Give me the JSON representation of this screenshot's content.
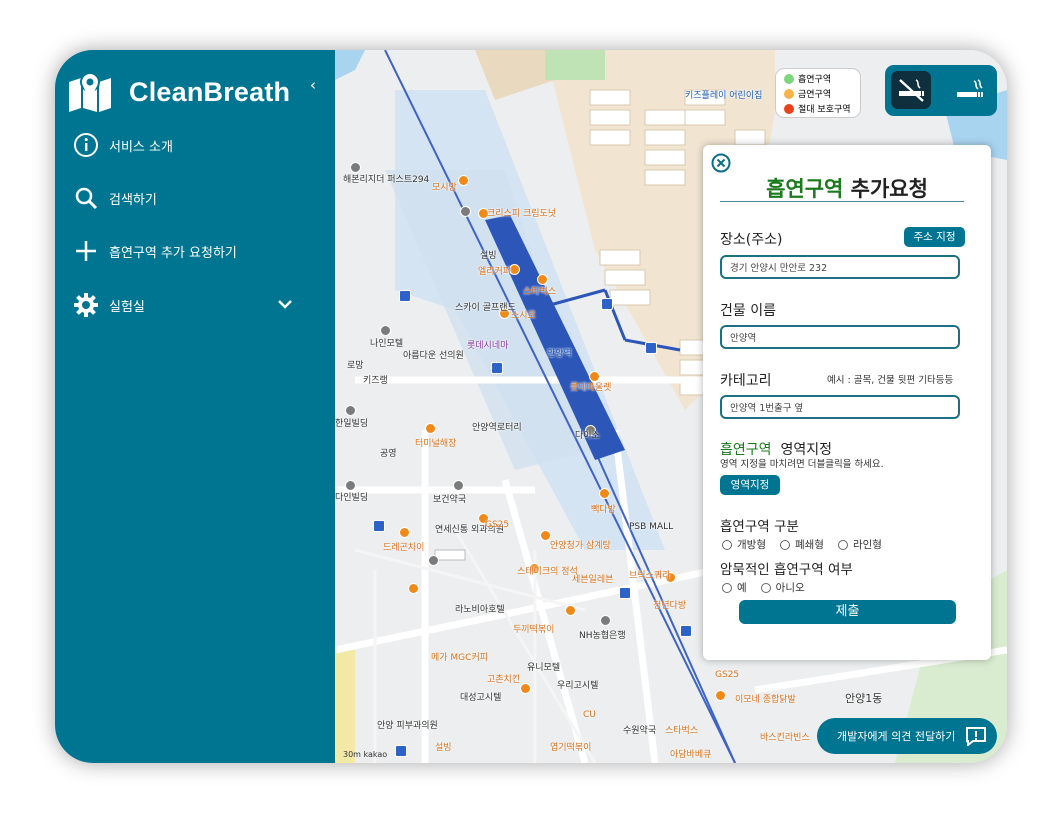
{
  "app": {
    "name": "CleanBreath",
    "collapse_glyph": "‹"
  },
  "sidebar": {
    "items": [
      {
        "label": "서비스 소개",
        "icon": "info-icon"
      },
      {
        "label": "검색하기",
        "icon": "search-icon"
      },
      {
        "label": "흡연구역 추가 요청하기",
        "icon": "plus-icon"
      },
      {
        "label": "실험실",
        "icon": "gear-icon"
      }
    ]
  },
  "legend": [
    {
      "label": "흡연구역",
      "color": "#7ed67e"
    },
    {
      "label": "금연구역",
      "color": "#f7b24c"
    },
    {
      "label": "절대 보호구역",
      "color": "#e8441c"
    }
  ],
  "map_labels": {
    "poi": [
      "해본리지더 퍼스트294",
      "모시망",
      "크리스피 크림도넛",
      "설빙",
      "엘리커피",
      "스타벅스",
      "스카이 골프랜드",
      "스시로",
      "안양역",
      "롯데시네마",
      "나인모텔",
      "아름다운 선의원",
      "로망",
      "키즈랭",
      "롯데아울렛",
      "한일빌딩",
      "안양역로터리",
      "다이소",
      "공영",
      "터미널해장",
      "보건약국",
      "다인빌딩",
      "연세신통 외과의원",
      "GS25",
      "PSB MALL",
      "드레곤차이",
      "빽다방",
      "안양청가 삼계탕",
      "스테이크의 정석",
      "세븐일레븐",
      "브릭스쿼라",
      "청년다방",
      "라노비아호텔",
      "NH농협은행",
      "유니모텔",
      "고촌치킨",
      "우리고시텔",
      "대성고시텔",
      "CU",
      "이모네 종합닭발",
      "수원약국",
      "스타벅스",
      "아담바베큐",
      "안양 피부과의원",
      "키즈플레이 어린이집",
      "설빙",
      "바스킨라빈스",
      "안양1동",
      "GS25",
      "두끼떡볶이",
      "메가 MGC커피",
      "엽기떡볶이"
    ],
    "scale": "30m kakao"
  },
  "form": {
    "title_green": "흡연구역",
    "title_rest": " 추가요청",
    "address_label": "장소(주소)",
    "address_button": "주소 지정",
    "address_value": "경기 안양시 만안로 232",
    "building_label": "건물 이름",
    "building_value": "안양역",
    "category_label": "카테고리",
    "category_hint": "예시 : 골목, 건물 뒷편 기타등등",
    "category_value": "안양역 1번출구 옆",
    "area_label_green": "흡연구역",
    "area_label_rest": "영역지정",
    "area_hint": "영역 지정을 마치려면 더블클릭을 하세요.",
    "area_button": "영역지정",
    "type_label": "흡연구역 구분",
    "type_options": [
      "개방형",
      "폐쇄형",
      "라인형"
    ],
    "hidden_label": "암묵적인 흡연구역 여부",
    "hidden_options": [
      "예",
      "아니오"
    ],
    "submit_label": "제출"
  },
  "feedback_button": "개발자에게 의견 전달하기",
  "colors": {
    "primary": "#007591",
    "green": "#1b7a1b"
  }
}
